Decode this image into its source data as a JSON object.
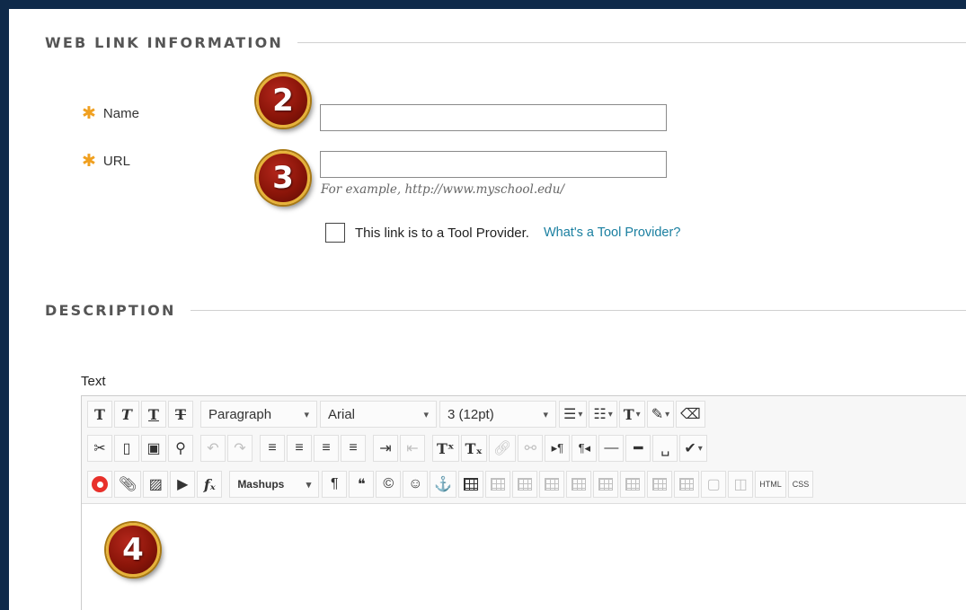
{
  "sections": {
    "web_link_info": "WEB LINK INFORMATION",
    "description": "DESCRIPTION"
  },
  "fields": {
    "name": {
      "label": "Name",
      "value": ""
    },
    "url": {
      "label": "URL",
      "value": "",
      "hint": "For example, http://www.myschool.edu/"
    },
    "required_marker": "✱"
  },
  "tool_provider": {
    "checkbox_label": "This link is to a Tool Provider.",
    "help_link": "What's a Tool Provider?",
    "checked": false
  },
  "badges": [
    "2",
    "3",
    "4"
  ],
  "editor": {
    "label": "Text",
    "paragraph_select": "Paragraph",
    "font_select": "Arial",
    "size_select": "3 (12pt)",
    "mashups_label": "Mashups",
    "html_label": "HTML",
    "css_label": "CSS",
    "content": ""
  },
  "colors": {
    "frame": "#0f2a4a",
    "required_star": "#f0a020",
    "link": "#1a7fa0",
    "badge_fill": "#8a1509",
    "badge_ring": "#e6b23a"
  }
}
